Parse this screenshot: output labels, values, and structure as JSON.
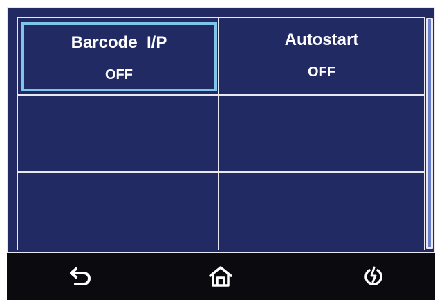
{
  "cells": [
    {
      "label": "Barcode  I/P",
      "value": "OFF",
      "selected": true
    },
    {
      "label": "Autostart",
      "value": "OFF",
      "selected": false
    },
    {
      "label": "",
      "value": ""
    },
    {
      "label": "",
      "value": ""
    },
    {
      "label": "",
      "value": ""
    },
    {
      "label": "",
      "value": ""
    }
  ],
  "bottom_bar": {
    "buttons": [
      "back-icon",
      "home-icon",
      "power-icon"
    ]
  },
  "colors": {
    "background": "#222a64",
    "grid_line": "#e8e8ee",
    "selection": "#7fc4ea",
    "bar": "#0a0a0f"
  }
}
